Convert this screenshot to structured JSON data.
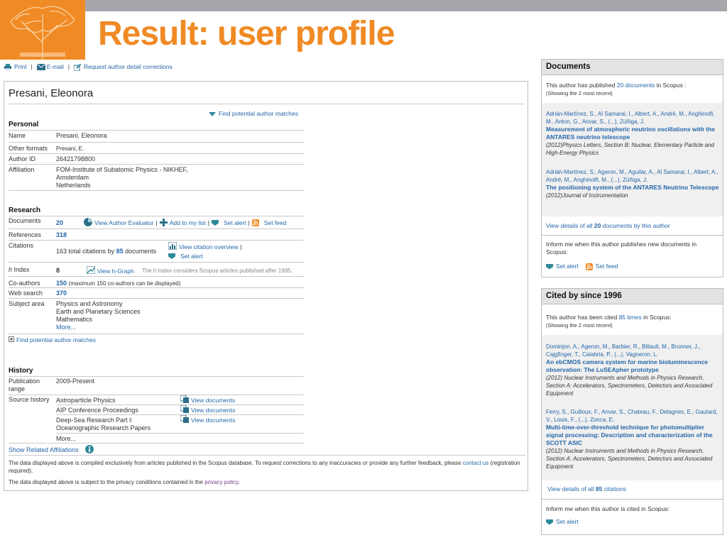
{
  "slide": {
    "title": "Result: user profile"
  },
  "actions": {
    "print": "Print",
    "email": "E-mail",
    "request": "Request author detail corrections"
  },
  "profile": {
    "name": "Presani, Eleonora",
    "find_matches_top": "Find potential author matches",
    "personal_heading": "Personal",
    "personal": [
      {
        "label": "Name",
        "value": "Presani, Eleonora"
      },
      {
        "label": "Other formats",
        "value": "Presani, E."
      },
      {
        "label": "Author ID",
        "value": "26421798800"
      },
      {
        "label": "Affiliation",
        "value": "FOM-Institute of Subatomic Physics - NIKHEF, Amsterdam Netherlands",
        "lines": [
          "FOM-Institute of Subatomic Physics - NIKHEF,",
          "Amsterdam",
          "Netherlands"
        ]
      }
    ],
    "research_heading": "Research",
    "research": {
      "documents_label": "Documents",
      "documents_count": "20",
      "view_evaluator": "View Author Evaluator",
      "add_to_list": "Add to my list",
      "set_alert": "Set alert",
      "set_feed": "Set feed",
      "references_label": "References",
      "references_count": "318",
      "citations_label": "Citations",
      "citations_text_pre": "163 total citations by",
      "citations_docs": "85",
      "citations_text_post": "documents",
      "view_citation_overview": "View citation overview",
      "citations_set_alert": "Set alert",
      "hindex_label": "h Index",
      "hindex_label_h": "h",
      "hindex_label_rest": "Index",
      "hindex_value": "8",
      "view_hgraph": "View h-Graph",
      "hindex_note": "The h Index considers Scopus articles published after 1995.",
      "coauthors_label": "Co-authors",
      "coauthors_count": "150",
      "coauthors_note": "(maximum 150 co-authors can be displayed)",
      "websearch_label": "Web search",
      "websearch_count": "370",
      "subject_label": "Subject area",
      "subjects": [
        "Physics and Astronomy",
        "Earth and Planetary Sciences",
        "Mathematics"
      ],
      "subject_more": "More..."
    },
    "find_matches_bottom": "Find potential author matches",
    "history_heading": "History",
    "history": {
      "pub_range_label_1": "Publication",
      "pub_range_label_2": "range",
      "pub_range_value": "2009-Present",
      "source_label": "Source history",
      "sources": [
        {
          "name": "Astroparticle Physics",
          "action": "View documents"
        },
        {
          "name": "AIP Conference Proceedings",
          "action": "View documents"
        },
        {
          "name_1": "Deep-Sea Research Part I:",
          "name_2": "Oceanographic Research Papers",
          "action": "View documents"
        }
      ],
      "more": "More..."
    },
    "show_affiliations": "Show Related Affiliations",
    "footer_1_pre": "The data displayed above is compiled exclusively from articles published in the Scopus database. To request corrections to any inaccuracies or provide any further feedback, please",
    "footer_1_link": "contact us",
    "footer_1_post": "(registration required).",
    "footer_2_pre": "The data displayed above is subject to the privacy conditions contained in the",
    "footer_2_link": "privacy policy",
    "footer_2_post": "."
  },
  "documents_panel": {
    "heading": "Documents",
    "intro_pre": "This author has published",
    "intro_count": "20",
    "intro_link": "documents",
    "intro_post": "in Scopus :",
    "showing": "(Showing the 2 most recent)",
    "items": [
      {
        "authors": "Adrián-Martínez, S., Al Samarai, I., Albert, A., André, M., Anghinolfi, M., Anton, G., Anvar, S., (...), Zúñiga, J.",
        "title": "Measurement of atmospheric neutrino oscillations with the ANTARES neutrino telescope",
        "source": "(2012)Physics Letters, Section B: Nuclear, Elementary Particle and High-Energy Physics"
      },
      {
        "authors": "Adrián-Martínez, S., Ageron, M., Aguilar, A., Al Samarai, I., Albert, A., André, M., Anghinolfi, M., (...), Zúñiga, J.",
        "title": "The positioning system of the ANTARES Neutrino Telescope",
        "source": "(2012)Journal of Instrumentation"
      }
    ],
    "view_all_pre": "View details of all",
    "view_all_count": "20",
    "view_all_post": "documents by this author",
    "inform": "Inform me when this author publishes new documents in Scopus:",
    "set_alert": "Set alert",
    "set_feed": "Set feed"
  },
  "cited_panel": {
    "heading": "Cited by since 1996",
    "intro_pre": "This author has been cited",
    "intro_count": "85",
    "intro_link": "times",
    "intro_post": "in Scopus:",
    "showing": "(Showing the 2 most recent)",
    "items": [
      {
        "authors": "Dominjon, A., Ageron, M., Barbier, R., Billault, M., Brunner, J., Cajgfinger, T., Calabria, P., (...), Vagneron, L.",
        "title": "An ebCMOS camera system for marine bioluminescence observation: The LuSEApher prototype",
        "source": "(2012) Nuclear Instruments and Methods in Physics Research, Section A: Accelerators, Spectrometers, Detectors and Associated Equipment"
      },
      {
        "authors": "Ferry, S., Guilloux, F., Anvar, S., Chateau, F., Delagnes, E., Gautard, V., Louis, F., (...), Zonca, E.",
        "title": "Multi-time-over-threshold technique for photomultiplier signal processing: Description and characterization of the SCOTT ASIC",
        "source": "(2012) Nuclear Instruments and Methods in Physics Research, Section A: Accelerators, Spectrometers, Detectors and Associated Equipment"
      }
    ],
    "view_all_pre": "View details of all",
    "view_all_count": "85",
    "view_all_post": "citations",
    "inform": "Inform me when this author is cited in Scopus:",
    "set_alert": "Set alert"
  }
}
